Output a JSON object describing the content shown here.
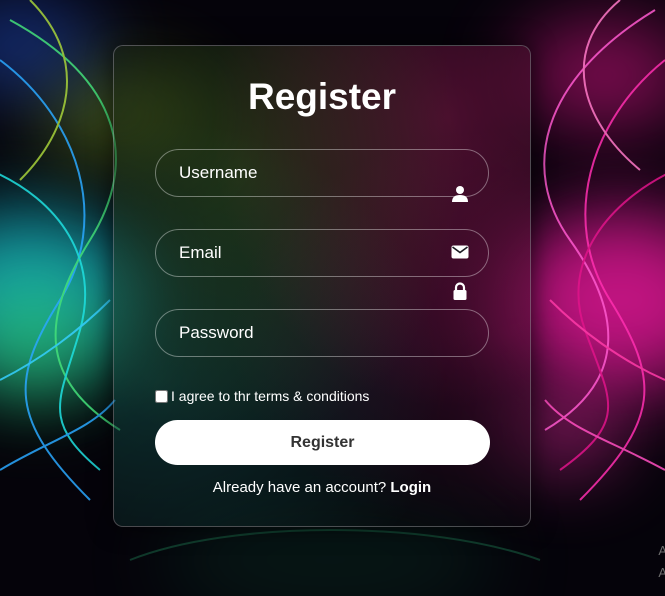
{
  "form": {
    "title": "Register",
    "username_placeholder": "Username",
    "email_placeholder": "Email",
    "password_placeholder": "Password",
    "agree_text": "I agree to thr terms & conditions",
    "register_button": "Register",
    "footer_text": "Already have an account?",
    "login_link": "Login"
  },
  "icons": {
    "username": "user-icon",
    "email": "envelope-icon",
    "password": "lock-icon"
  },
  "watermark": {
    "line1": "A",
    "line2": "A"
  },
  "colors": {
    "button_bg": "#ffffff",
    "button_text": "#333333",
    "text": "#ffffff"
  }
}
